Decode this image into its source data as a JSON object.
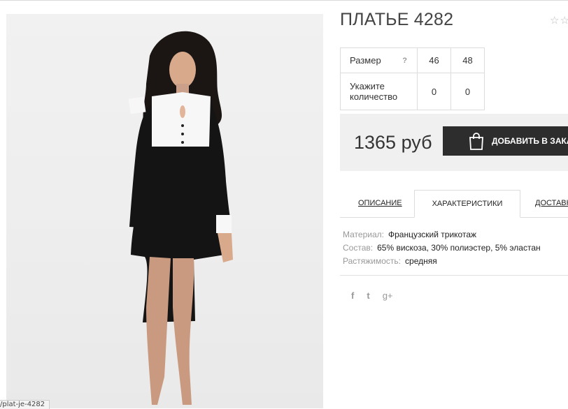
{
  "status_url": "/plat-je-4282",
  "product": {
    "title": "ПЛАТЬЕ 4282",
    "rating_icon": "☆☆"
  },
  "sizes": {
    "size_label": "Размер",
    "help_icon": "?",
    "qty_label": "Укажите количество",
    "options": [
      {
        "size": "46",
        "qty": "0"
      },
      {
        "size": "48",
        "qty": "0"
      }
    ]
  },
  "price": {
    "value": "1365 руб",
    "buy_label": "ДОБАВИТЬ В ЗАКАЗ"
  },
  "tabs": [
    {
      "label": "ОПИСАНИЕ"
    },
    {
      "label": "ХАРАКТЕРИСТИКИ"
    },
    {
      "label": "ДОСТАВКА"
    }
  ],
  "specs": [
    {
      "key": "Материал:",
      "value": "Французский трикотаж"
    },
    {
      "key": "Состав:",
      "value": "65% вискоза, 30% полиэстер, 5% эластан"
    },
    {
      "key": "Растяжимость:",
      "value": "средняя"
    }
  ],
  "social": {
    "facebook": "f",
    "twitter": "t",
    "google": "g+"
  },
  "colors": {
    "button": "#2d2d2d",
    "price_bg": "#f0f0f0"
  }
}
